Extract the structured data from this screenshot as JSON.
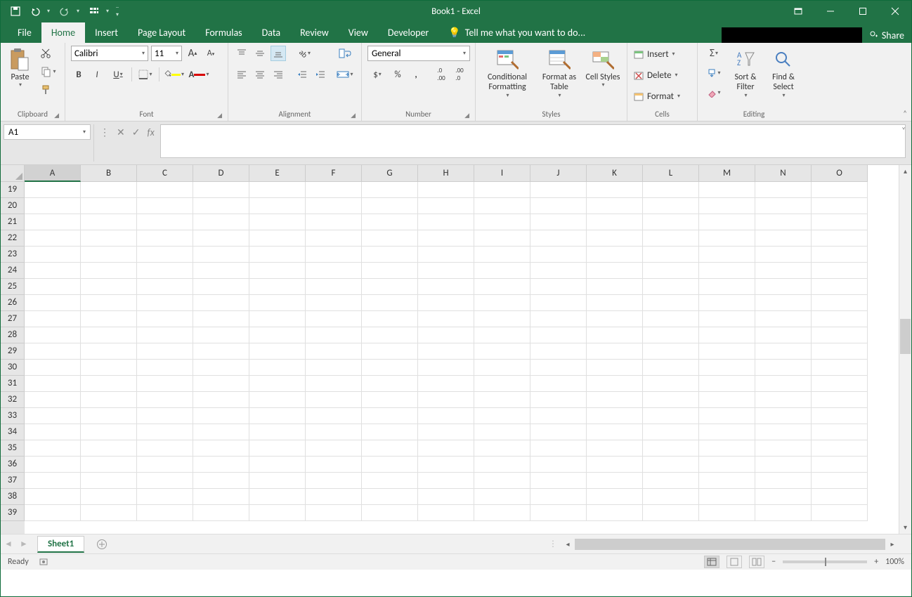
{
  "titlebar": {
    "title": "Book1 - Excel"
  },
  "qat": {
    "save": "save-icon",
    "undo": "undo-icon",
    "redo": "redo-icon",
    "touch": "touch-mode-icon",
    "customize": "customize-qat-icon"
  },
  "tabs": {
    "items": [
      "File",
      "Home",
      "Insert",
      "Page Layout",
      "Formulas",
      "Data",
      "Review",
      "View",
      "Developer"
    ],
    "activeIndex": 1,
    "tellme": "Tell me what you want to do...",
    "share": "Share"
  },
  "ribbon": {
    "clipboard": {
      "paste": "Paste",
      "label": "Clipboard"
    },
    "font": {
      "name": "Calibri",
      "size": "11",
      "label": "Font",
      "bold": "B",
      "italic": "I",
      "underline": "U"
    },
    "alignment": {
      "label": "Alignment"
    },
    "number": {
      "format": "General",
      "label": "Number"
    },
    "styles": {
      "cond": "Conditional Formatting",
      "table": "Format as Table",
      "cell": "Cell Styles",
      "label": "Styles"
    },
    "cells": {
      "insert": "Insert",
      "delete": "Delete",
      "format": "Format",
      "label": "Cells"
    },
    "editing": {
      "sort": "Sort & Filter",
      "find": "Find & Select",
      "label": "Editing"
    }
  },
  "formulabar": {
    "namebox": "A1",
    "fx": "fx"
  },
  "grid": {
    "columns": [
      "A",
      "B",
      "C",
      "D",
      "E",
      "F",
      "G",
      "H",
      "I",
      "J",
      "K",
      "L",
      "M",
      "N",
      "O"
    ],
    "rowStart": 19,
    "rowEnd": 39
  },
  "sheetbar": {
    "active": "Sheet1"
  },
  "statusbar": {
    "ready": "Ready",
    "zoom": "100%"
  }
}
